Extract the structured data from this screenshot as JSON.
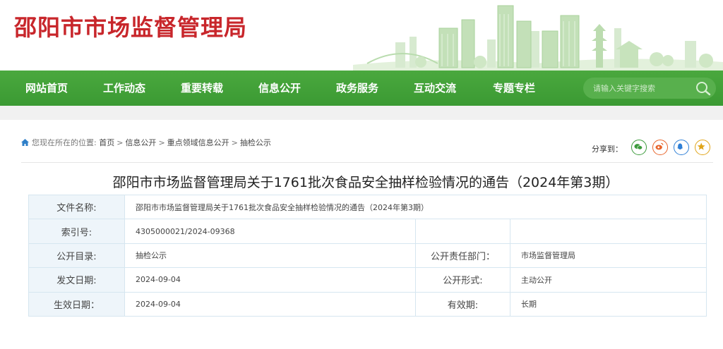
{
  "site": {
    "title": "邵阳市市场监督管理局"
  },
  "nav": {
    "items": [
      {
        "label": "网站首页"
      },
      {
        "label": "工作动态"
      },
      {
        "label": "重要转载"
      },
      {
        "label": "信息公开"
      },
      {
        "label": "政务服务"
      },
      {
        "label": "互动交流"
      },
      {
        "label": "专题专栏"
      }
    ],
    "search_placeholder": "请输入关键字搜索"
  },
  "breadcrumb": {
    "prefix": "您现在所在的位置:",
    "items": [
      "首页",
      "信息公开",
      "重点领域信息公开",
      "抽检公示"
    ],
    "separator": ">"
  },
  "share": {
    "label": "分享到：",
    "buttons": [
      {
        "name": "wechat-share-icon",
        "color": "#3a9a3a"
      },
      {
        "name": "weibo-share-icon",
        "color": "#e8652b"
      },
      {
        "name": "qq-share-icon",
        "color": "#2e7fd6"
      },
      {
        "name": "qzone-share-icon",
        "color": "#e0a418"
      }
    ]
  },
  "document": {
    "title": "邵阳市市场监督管理局关于1761批次食品安全抽样检验情况的通告（2024年第3期）",
    "meta": {
      "name_label": "文件名称:",
      "name_value": "邵阳市市场监督管理局关于1761批次食品安全抽样检验情况的通告（2024年第3期）",
      "index_label": "索引号:",
      "index_value": "4305000021/2024-09368",
      "catalog_label": "公开目录:",
      "catalog_value": "抽检公示",
      "dept_label": "公开责任部门：",
      "dept_value": "市场监督管理局",
      "date_label": "发文日期:",
      "date_value": "2024-09-04",
      "form_label": "公开形式:",
      "form_value": "主动公开",
      "effective_label": "生效日期：",
      "effective_value": "2024-09-04",
      "validity_label": "有效期:",
      "validity_value": "长期"
    }
  },
  "colors": {
    "brand_red": "#c8262b",
    "nav_green": "#3b9a33"
  }
}
